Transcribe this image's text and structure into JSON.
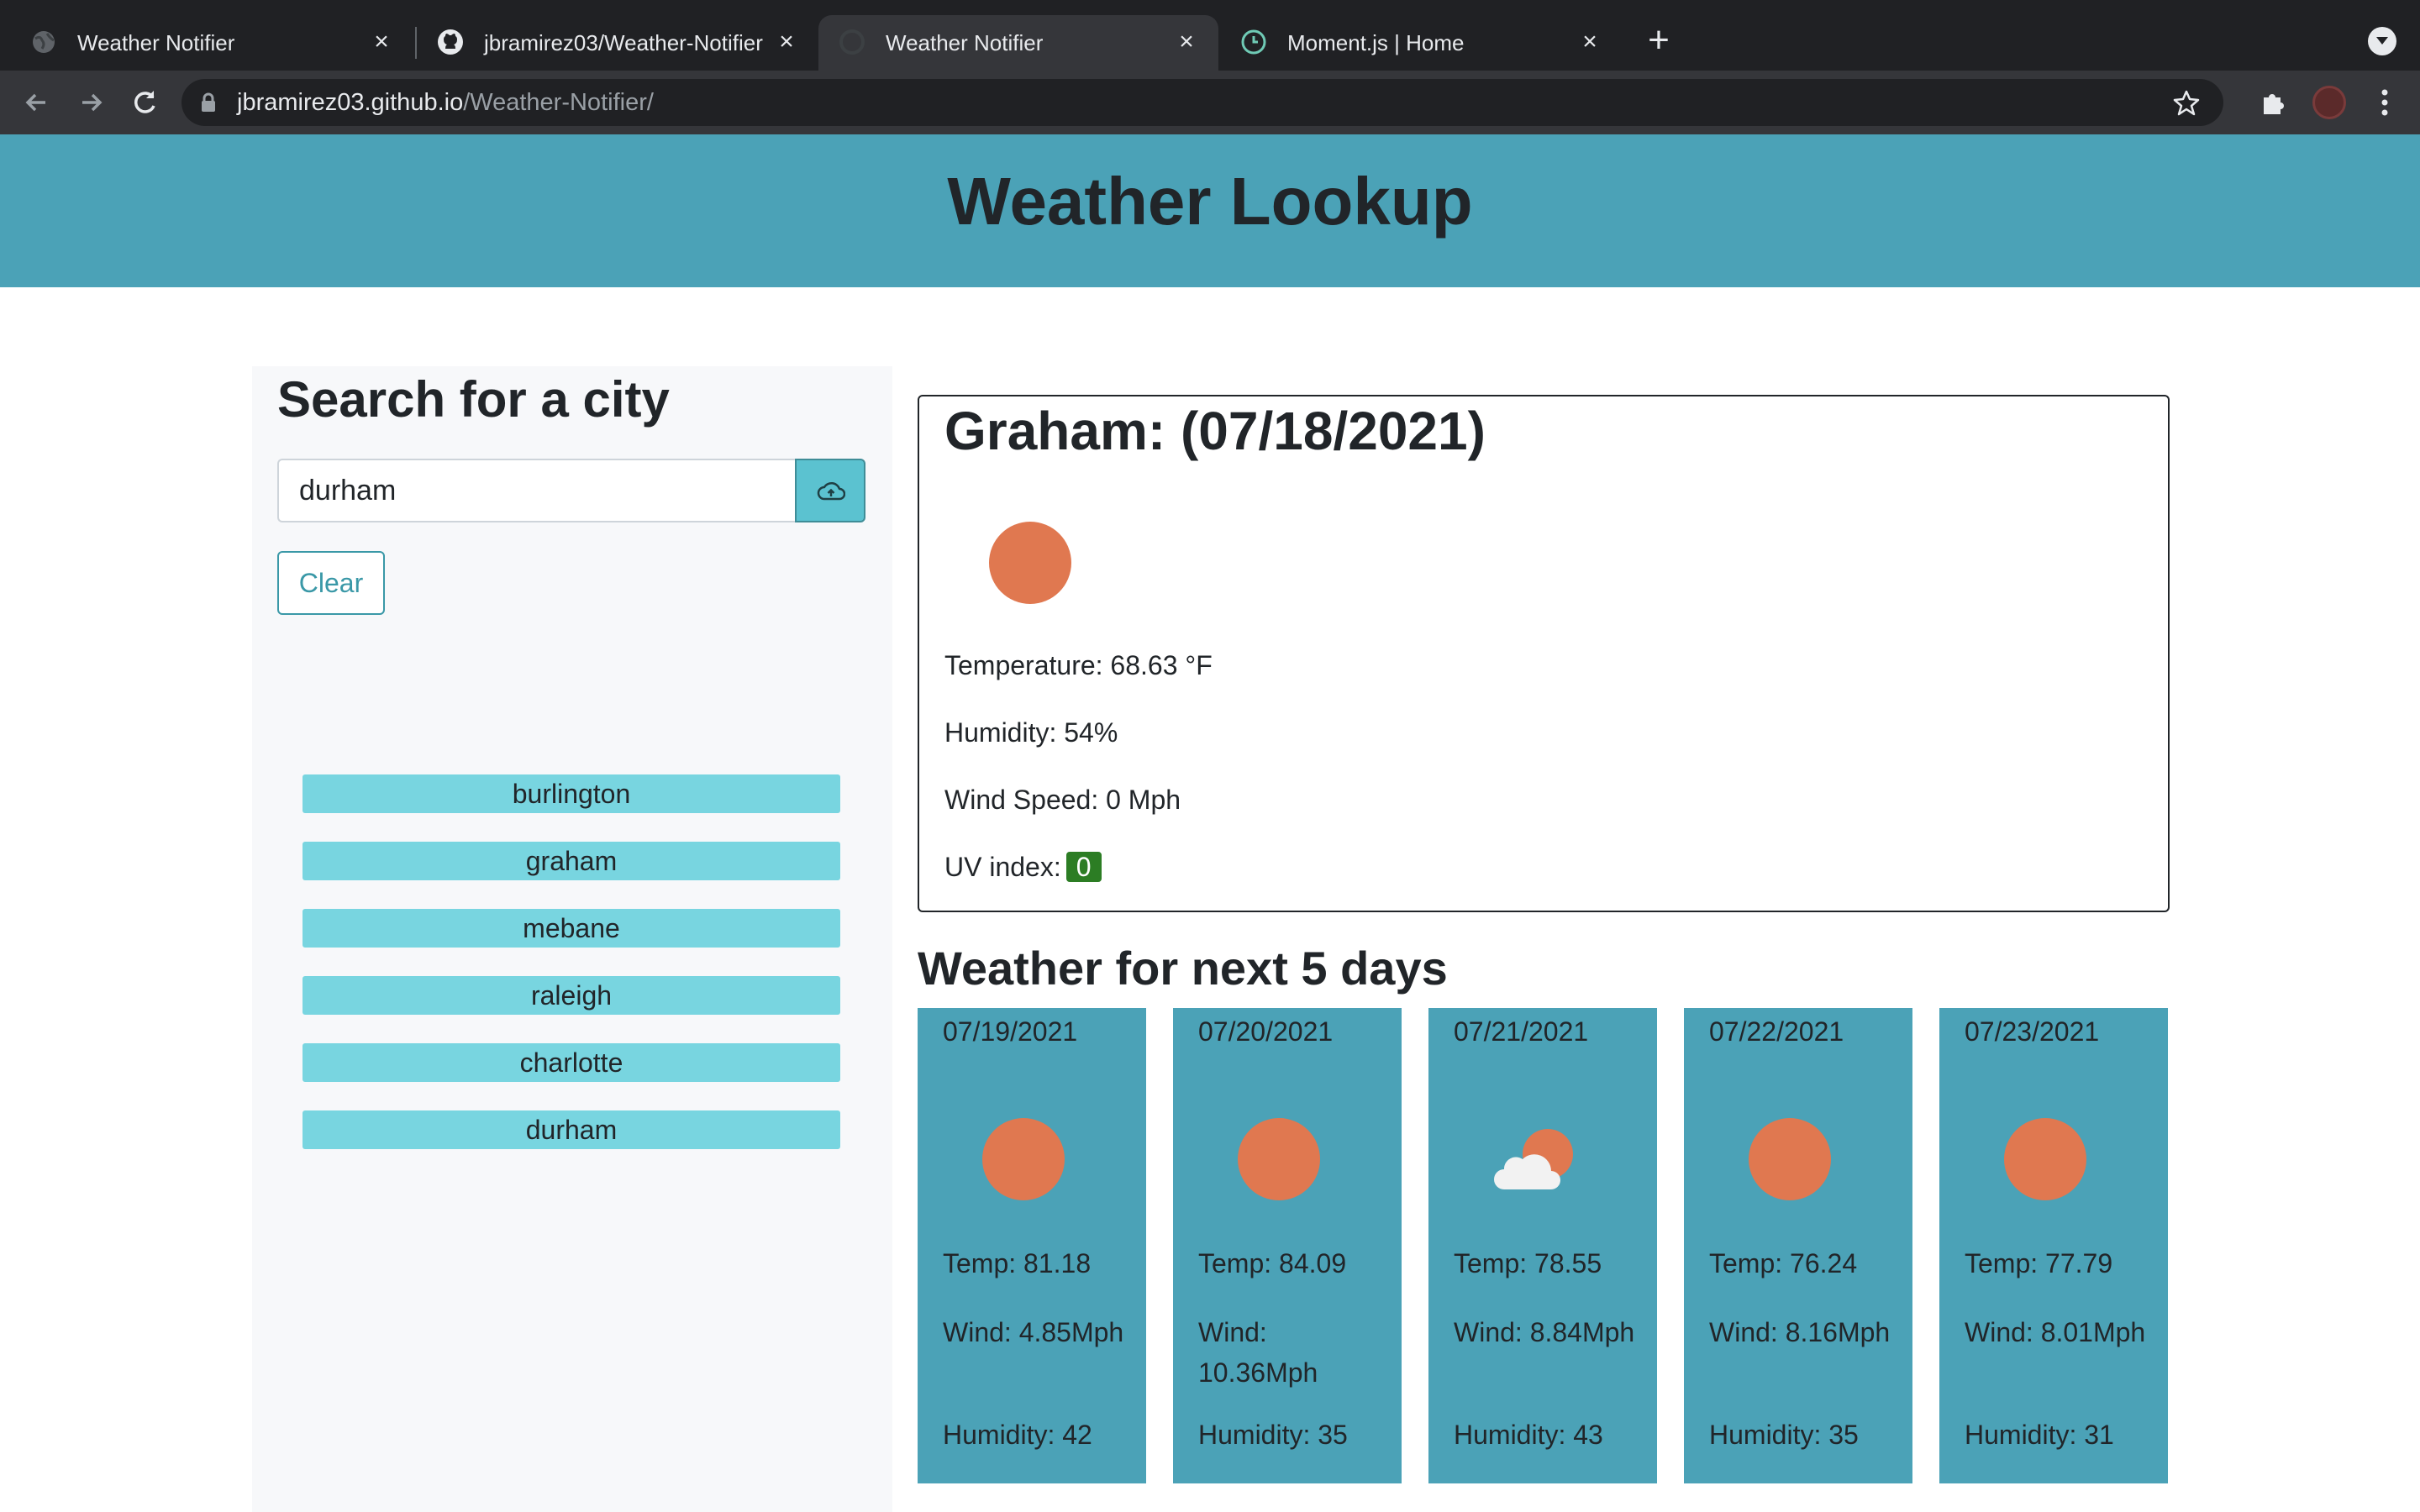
{
  "browser": {
    "tabs": [
      {
        "title": "Weather Notifier",
        "icon": "globe-icon",
        "active": false
      },
      {
        "title": "jbramirez03/Weather-Notifier",
        "icon": "github-icon",
        "active": false
      },
      {
        "title": "Weather Notifier",
        "icon": "loading-icon",
        "active": true
      },
      {
        "title": "Moment.js | Home",
        "icon": "clock-icon",
        "active": false
      }
    ],
    "url_host": "jbramirez03.github.io",
    "url_path": "/Weather-Notifier/"
  },
  "header": {
    "title": "Weather Lookup"
  },
  "search": {
    "title": "Search for a city",
    "input_value": "durham",
    "clear_label": "Clear",
    "history": [
      "burlington",
      "graham",
      "mebane",
      "raleigh",
      "charlotte",
      "durham"
    ]
  },
  "current": {
    "title": "Graham: (07/18/2021)",
    "icon": "sun-icon",
    "temperature": "Temperature: 68.63 °F",
    "humidity": "Humidity: 54%",
    "wind": "Wind Speed: 0 Mph",
    "uv_label": "UV index:",
    "uv_value": "0",
    "uv_color": "#2c7d24"
  },
  "forecast": {
    "title": "Weather for next 5 days",
    "days": [
      {
        "date": "07/19/2021",
        "icon": "sun-icon",
        "temp": "Temp: 81.18",
        "wind": "Wind: 4.85Mph",
        "humidity": "Humidity: 42"
      },
      {
        "date": "07/20/2021",
        "icon": "sun-icon",
        "temp": "Temp: 84.09",
        "wind": "Wind: 10.36Mph",
        "humidity": "Humidity: 35"
      },
      {
        "date": "07/21/2021",
        "icon": "partly-cloudy-icon",
        "temp": "Temp: 78.55",
        "wind": "Wind: 8.84Mph",
        "humidity": "Humidity: 43"
      },
      {
        "date": "07/22/2021",
        "icon": "sun-icon",
        "temp": "Temp: 76.24",
        "wind": "Wind: 8.16Mph",
        "humidity": "Humidity: 35"
      },
      {
        "date": "07/23/2021",
        "icon": "sun-icon",
        "temp": "Temp: 77.79",
        "wind": "Wind: 8.01Mph",
        "humidity": "Humidity: 31"
      }
    ]
  },
  "colors": {
    "accent": "#4ba2b7",
    "history_button": "#78d5e0",
    "sun": "#e07850"
  }
}
